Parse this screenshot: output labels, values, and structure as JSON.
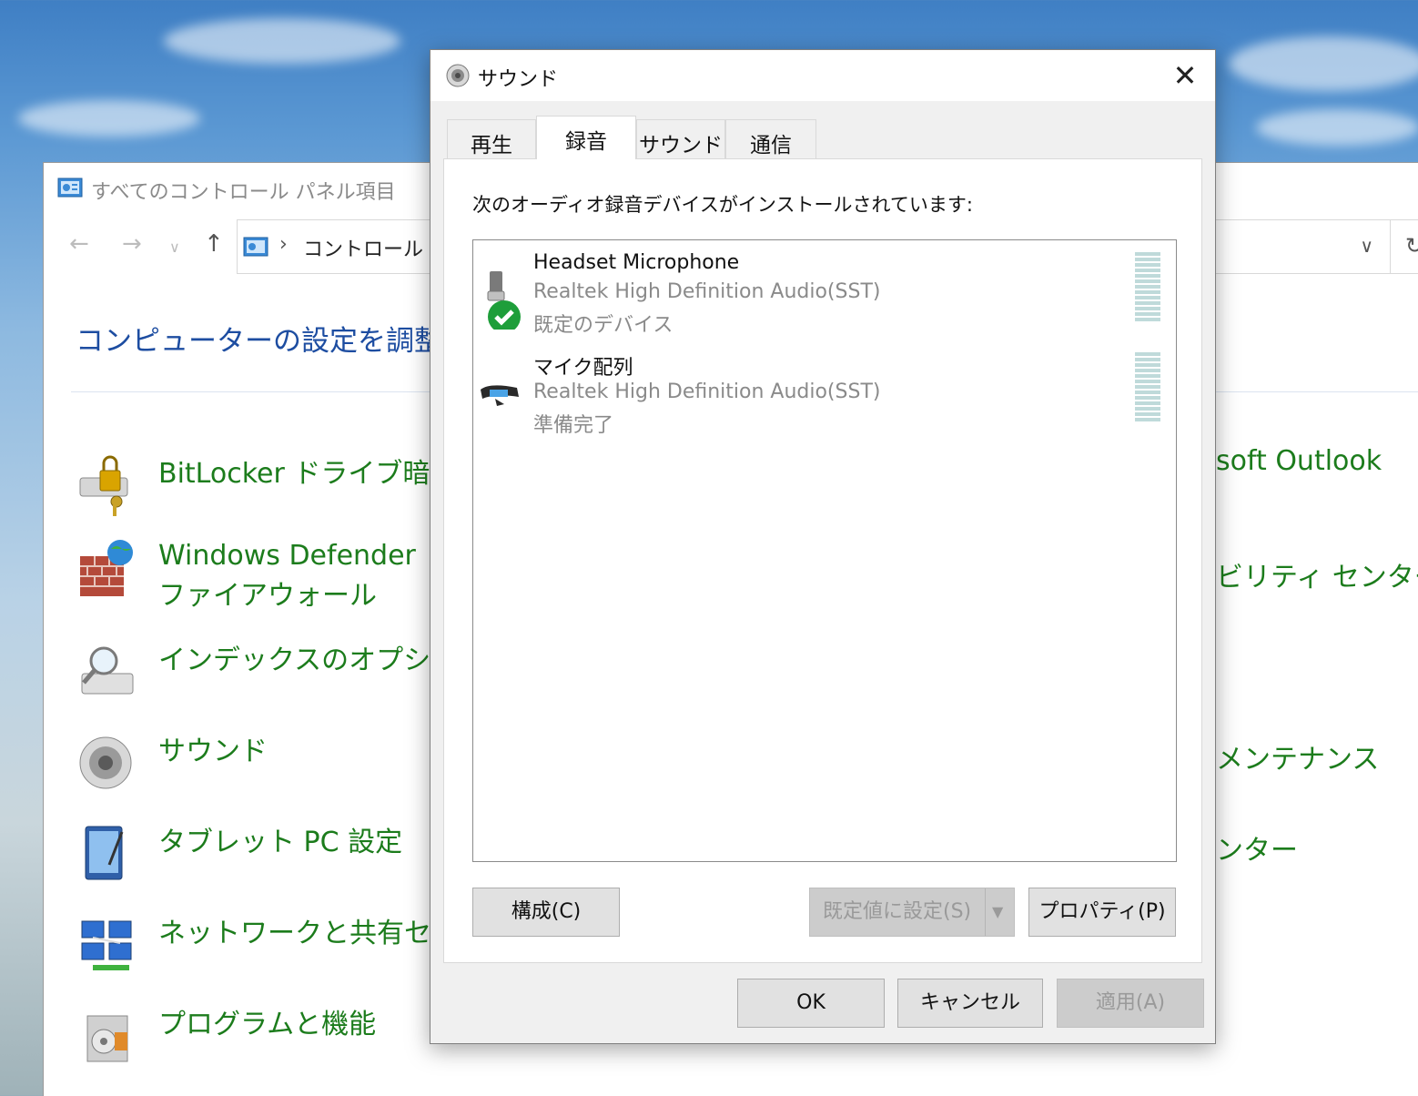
{
  "control_panel": {
    "title": "すべてのコントロール パネル項目",
    "address_crumb": "コントロール パネ",
    "heading": "コンピューターの設定を調整しま",
    "items": [
      {
        "label": "BitLocker ドライブ暗号化",
        "icon": "bitlocker-icon"
      },
      {
        "label": "Windows Defender ファイアウォール",
        "icon": "firewall-icon"
      },
      {
        "label": "インデックスのオプション",
        "icon": "indexing-icon"
      },
      {
        "label": "サウンド",
        "icon": "speaker-icon"
      },
      {
        "label": "タブレット PC 設定",
        "icon": "tablet-icon"
      },
      {
        "label": "ネットワークと共有センター",
        "icon": "network-icon"
      },
      {
        "label": "プログラムと機能",
        "icon": "programs-icon"
      }
    ],
    "right_items": [
      "soft Outlook",
      "ビリティ センター",
      "メンテナンス",
      "ンター"
    ]
  },
  "dialog": {
    "title": "サウンド",
    "tabs": [
      {
        "label": "再生",
        "active": false
      },
      {
        "label": "録音",
        "active": true
      },
      {
        "label": "サウンド",
        "active": false
      },
      {
        "label": "通信",
        "active": false
      }
    ],
    "caption": "次のオーディオ録音デバイスがインストールされています:",
    "devices": [
      {
        "name": "Headset Microphone",
        "driver": "Realtek High Definition Audio(SST)",
        "status": "既定のデバイス",
        "is_default": true
      },
      {
        "name": "マイク配列",
        "driver": "Realtek High Definition Audio(SST)",
        "status": "準備完了",
        "is_default": false
      }
    ],
    "buttons": {
      "configure": "構成(C)",
      "set_default": "既定値に設定(S)",
      "properties": "プロパティ(P)",
      "ok": "OK",
      "cancel": "キャンセル",
      "apply": "適用(A)"
    }
  }
}
